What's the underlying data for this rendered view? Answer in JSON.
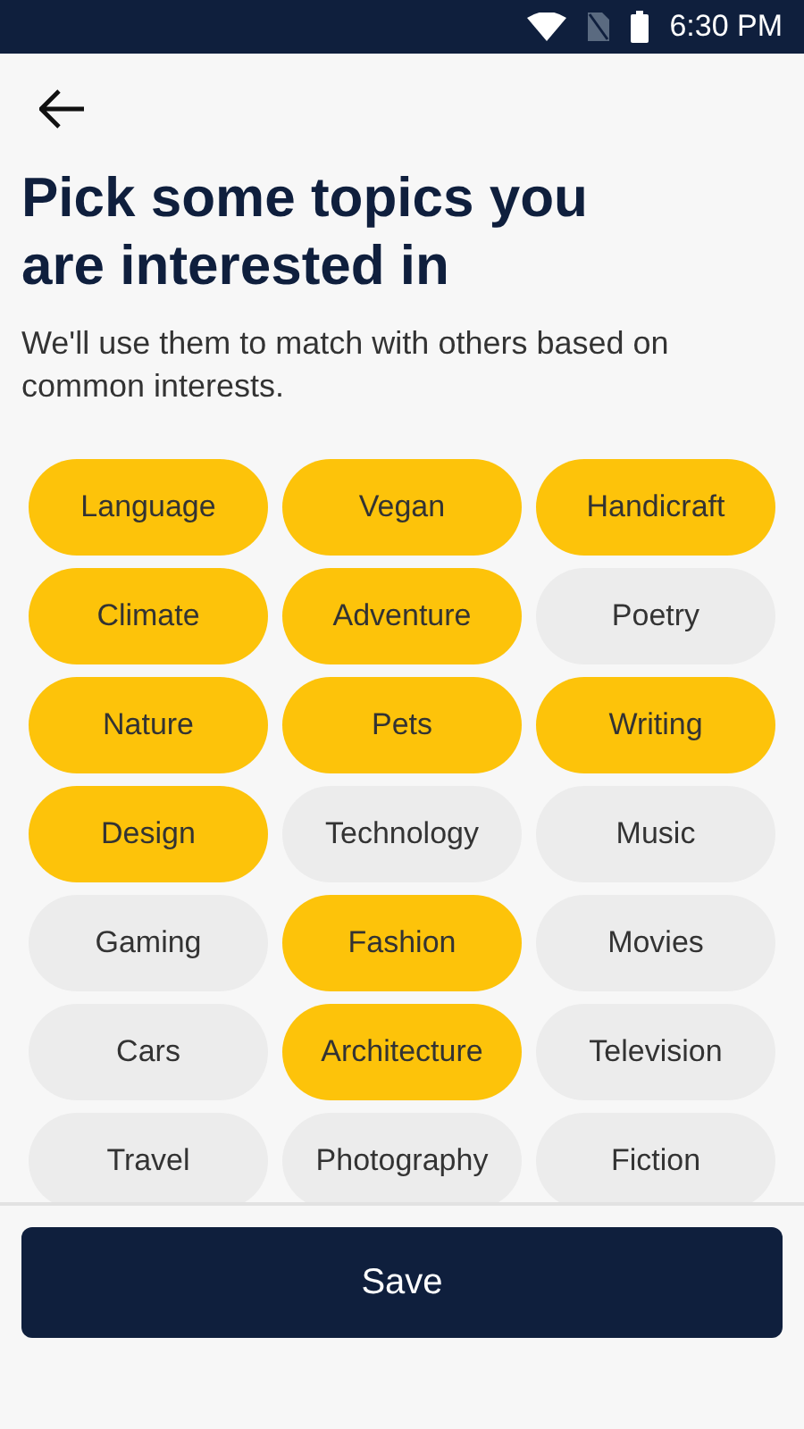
{
  "status_bar": {
    "time": "6:30 PM"
  },
  "title": "Pick some topics you are interested in",
  "subtitle": "We'll use them to match with others based on common interests.",
  "topics": [
    {
      "label": "Language",
      "selected": true
    },
    {
      "label": "Vegan",
      "selected": true
    },
    {
      "label": "Handicraft",
      "selected": true
    },
    {
      "label": "Climate",
      "selected": true
    },
    {
      "label": "Adventure",
      "selected": true
    },
    {
      "label": "Poetry",
      "selected": false
    },
    {
      "label": "Nature",
      "selected": true
    },
    {
      "label": "Pets",
      "selected": true
    },
    {
      "label": "Writing",
      "selected": true
    },
    {
      "label": "Design",
      "selected": true
    },
    {
      "label": "Technology",
      "selected": false
    },
    {
      "label": "Music",
      "selected": false
    },
    {
      "label": "Gaming",
      "selected": false
    },
    {
      "label": "Fashion",
      "selected": true
    },
    {
      "label": "Movies",
      "selected": false
    },
    {
      "label": "Cars",
      "selected": false
    },
    {
      "label": "Architecture",
      "selected": true
    },
    {
      "label": "Television",
      "selected": false
    },
    {
      "label": "Travel",
      "selected": false
    },
    {
      "label": "Photography",
      "selected": false
    },
    {
      "label": "Fiction",
      "selected": false
    }
  ],
  "save_button": "Save"
}
